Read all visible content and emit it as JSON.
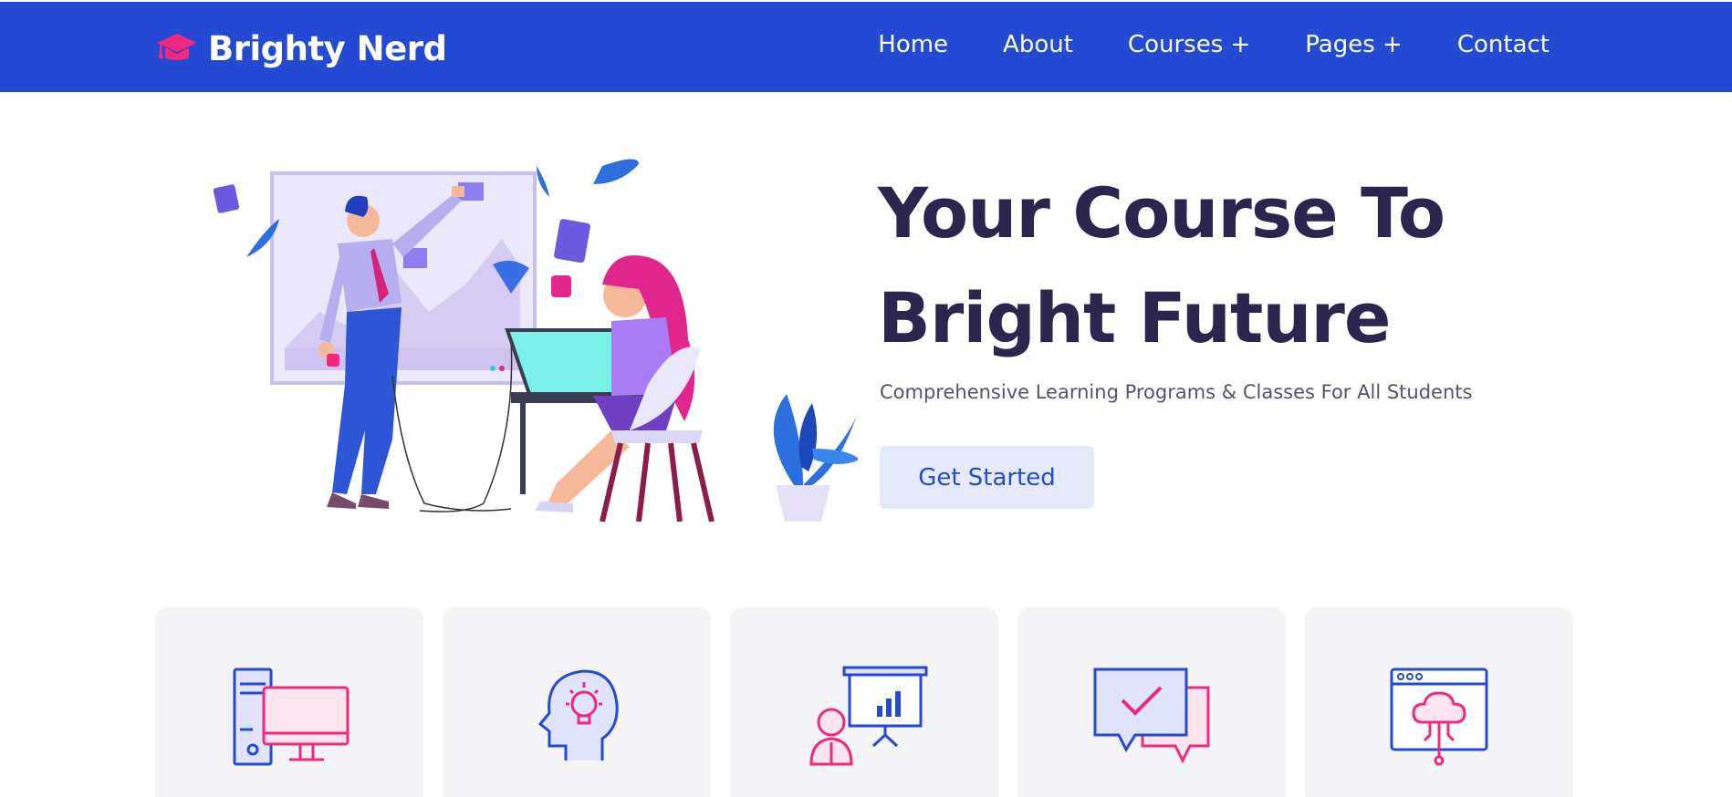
{
  "header": {
    "brand_name": "Brighty Nerd",
    "brand_icon": "graduation-cap-icon",
    "nav": [
      {
        "label": "Home"
      },
      {
        "label": "About"
      },
      {
        "label": "Courses +"
      },
      {
        "label": "Pages +"
      },
      {
        "label": "Contact"
      }
    ]
  },
  "hero": {
    "title_line1": "Your Course To",
    "title_line2": "Bright Future",
    "subtitle": "Comprehensive Learning Programs & Classes For All Students",
    "cta_label": "Get Started",
    "illustration": "people-working-illustration"
  },
  "features": [
    {
      "icon": "computer-icon"
    },
    {
      "icon": "idea-head-icon"
    },
    {
      "icon": "presentation-icon"
    },
    {
      "icon": "chat-check-icon"
    },
    {
      "icon": "cloud-browser-icon"
    }
  ],
  "colors": {
    "brand_blue": "#2449d3",
    "accent_pink": "#f0287e",
    "title_dark": "#2b2650",
    "card_bg": "#f4f4f6",
    "button_bg": "#e5eafb"
  }
}
